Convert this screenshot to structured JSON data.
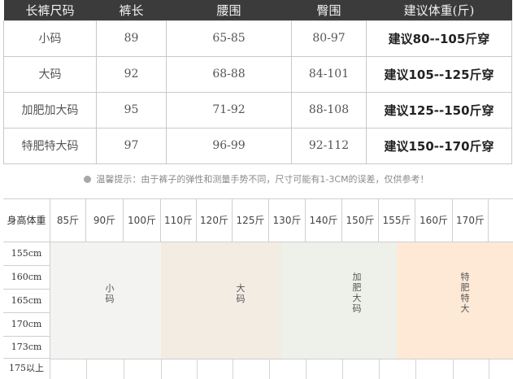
{
  "size_table": {
    "headers": [
      "长裤尺码",
      "裤长",
      "腰围",
      "臀围",
      "建议体重(斤)"
    ],
    "rows": [
      {
        "size": "小码",
        "length": "89",
        "waist": "65-85",
        "hip": "80-97",
        "rec": "建议80--105斤穿"
      },
      {
        "size": "大码",
        "length": "92",
        "waist": "68-88",
        "hip": "84-101",
        "rec": "建议105--125斤穿"
      },
      {
        "size": "加肥加大码",
        "length": "95",
        "waist": "71-92",
        "hip": "88-108",
        "rec": "建议125--150斤穿"
      },
      {
        "size": "特肥特大码",
        "length": "97",
        "waist": "96-99",
        "hip": "92-112",
        "rec": "建议150--170斤穿"
      }
    ]
  },
  "tip": "温馨提示：由于裤子的弹性和测量手势不同，尺寸可能有1-3CM的误差，仅供参考！",
  "grid": {
    "corner": "身高体重",
    "weights": [
      "85斤",
      "90斤",
      "100斤",
      "110斤",
      "120斤",
      "125斤",
      "130斤",
      "140斤",
      "150斤",
      "155斤",
      "160斤",
      "170斤"
    ],
    "heights": [
      "155cm",
      "160cm",
      "165cm",
      "170cm",
      "173cm",
      "175以上"
    ],
    "zones": [
      {
        "label": "小\n码"
      },
      {
        "label": "大\n码"
      },
      {
        "label": "加\n肥\n大\n码"
      },
      {
        "label": "特\n肥\n特\n大"
      }
    ],
    "colors": {
      "zone_small": "#f2f2f0",
      "zone_large": "#f1ebe2",
      "zone_xl": "#eef0ea",
      "zone_xxl": "#fde9d6"
    }
  }
}
